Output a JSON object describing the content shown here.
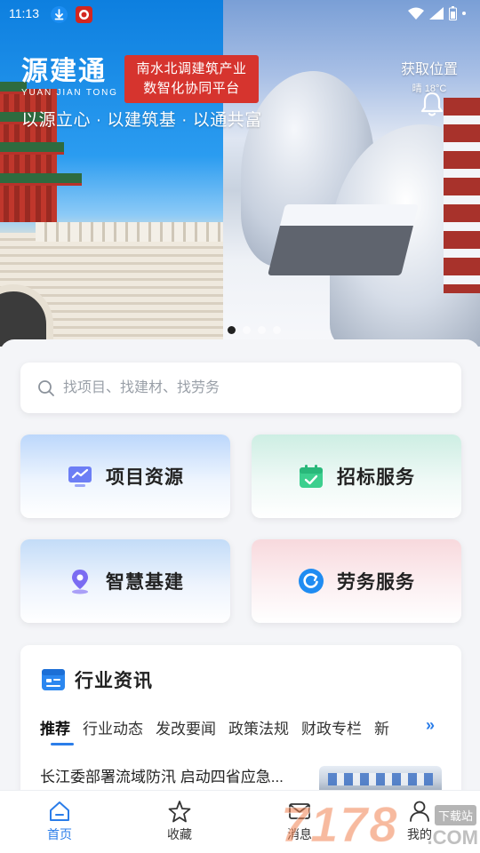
{
  "status_bar": {
    "time": "11:13"
  },
  "hero": {
    "logo_cn": "源建通",
    "logo_en": "YUAN JIAN TONG",
    "tagline_line1": "南水北调建筑产业",
    "tagline_line2": "数智化协同平台",
    "slogan": "以源立心 · 以建筑基 · 以通共富",
    "location_label": "获取位置",
    "weather": "晴 18°C",
    "carousel_active_index": 0,
    "carousel_count": 4
  },
  "search": {
    "placeholder": "找项目、找建材、找劳务"
  },
  "services": [
    {
      "label": "项目资源",
      "icon": "chart-monitor-icon"
    },
    {
      "label": "招标服务",
      "icon": "calendar-check-icon"
    },
    {
      "label": "智慧基建",
      "icon": "location-pin-icon"
    },
    {
      "label": "劳务服务",
      "icon": "circular-arrow-icon"
    }
  ],
  "news": {
    "title": "行业资讯",
    "tabs": [
      "推荐",
      "行业动态",
      "发改要闻",
      "政策法规",
      "财政专栏",
      "新"
    ],
    "active_tab": "推荐",
    "first_article": "长江委部署流域防汛 启动四省应急..."
  },
  "bottom_nav": [
    {
      "label": "首页",
      "icon": "home-icon",
      "active": true
    },
    {
      "label": "收藏",
      "icon": "star-icon",
      "active": false
    },
    {
      "label": "消息",
      "icon": "mail-icon",
      "active": false
    },
    {
      "label": "我的",
      "icon": "user-icon",
      "active": false
    }
  ],
  "watermark": {
    "text": "7178",
    "badge": "下载站",
    "suffix": ".COM"
  },
  "colors": {
    "accent": "#2b7de9",
    "tagline_bg": "#d6342e"
  }
}
